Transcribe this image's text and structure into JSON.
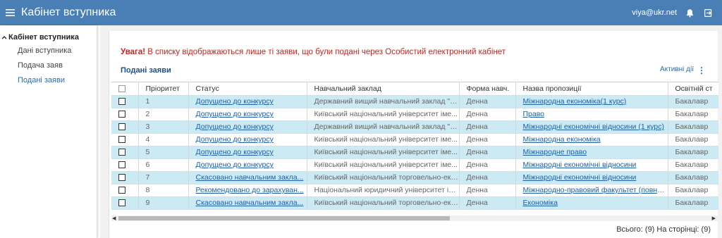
{
  "app": {
    "title": "Кабінет вступника",
    "user_email": "viya@ukr.net"
  },
  "sidebar": {
    "section_label": "Кабінет вступника",
    "items": [
      {
        "label": "Дані вступника",
        "active": false
      },
      {
        "label": "Подача заяв",
        "active": false
      },
      {
        "label": "Подані заяви",
        "active": true
      }
    ]
  },
  "main": {
    "warning_bold": "Увага!",
    "warning_text": " В списку відображаються лише ті заяви, що були подані через Особистий електронний кабінет",
    "section_title": "Подані заяви",
    "active_actions_label": "Активні дії",
    "table": {
      "headers": [
        "Пріоритет",
        "Статус",
        "Навчальний заклад",
        "Форма навч.",
        "Назва пропозиції",
        "Освітній ст"
      ],
      "rows": [
        {
          "priority": "1",
          "status": "Допущено до конкурсу",
          "institution": "Державний вищий навчальний заклад \"К...",
          "form": "Денна",
          "offer": "Міжнародна економіка(1 курс)",
          "level": "Бакалавр",
          "highlight": true
        },
        {
          "priority": "2",
          "status": "Допущено до конкурсу",
          "institution": "Київський національний університет іме...",
          "form": "Денна",
          "offer": "Право",
          "level": "Бакалавр",
          "highlight": false
        },
        {
          "priority": "3",
          "status": "Допущено до конкурсу",
          "institution": "Державний вищий навчальний заклад \"К...",
          "form": "Денна",
          "offer": "Міжнародні економічні відносини (1 курс)",
          "level": "Бакалавр",
          "highlight": true
        },
        {
          "priority": "4",
          "status": "Допущено до конкурсу",
          "institution": "Київський національний університет іме...",
          "form": "Денна",
          "offer": "Міжнародна економіка",
          "level": "Бакалавр",
          "highlight": false
        },
        {
          "priority": "5",
          "status": "Допущено до конкурсу",
          "institution": "Київський національний університет іме...",
          "form": "Денна",
          "offer": "Міжнародне право",
          "level": "Бакалавр",
          "highlight": true
        },
        {
          "priority": "6",
          "status": "Допущено до конкурсу",
          "institution": "Київський національний університет іме...",
          "form": "Денна",
          "offer": "Міжнародні економічні відносини",
          "level": "Бакалавр",
          "highlight": false
        },
        {
          "priority": "7",
          "status": "Скасовано навчальним закла...",
          "institution": "Київський національний торговельно-еко...",
          "form": "Денна",
          "offer": "Міжнародні економічні відносини",
          "level": "Бакалавр",
          "highlight": true
        },
        {
          "priority": "8",
          "status": "Рекомендовано до зарахуван...",
          "institution": "Національний юридичний університет ім...",
          "form": "Денна",
          "offer": "Міжнародно-правовий факультет (повна ...",
          "level": "Бакалавр",
          "highlight": false
        },
        {
          "priority": "9",
          "status": "Скасовано навчальним закла...",
          "institution": "Київський національний торговельно-еко...",
          "form": "Денна",
          "offer": "Економіка",
          "level": "Бакалавр",
          "highlight": true
        }
      ]
    },
    "footer_text": "Всього: (9) На сторінці: (9)"
  },
  "colors": {
    "topbar": "#4a7fb5",
    "row_highlight": "#cbeaf3",
    "warning": "#d0211c",
    "link": "#1f5fa8"
  },
  "icons": {
    "menu": "hamburger-icon",
    "bell": "bell-icon",
    "logout": "logout-icon",
    "caret": "caret-up-icon"
  }
}
